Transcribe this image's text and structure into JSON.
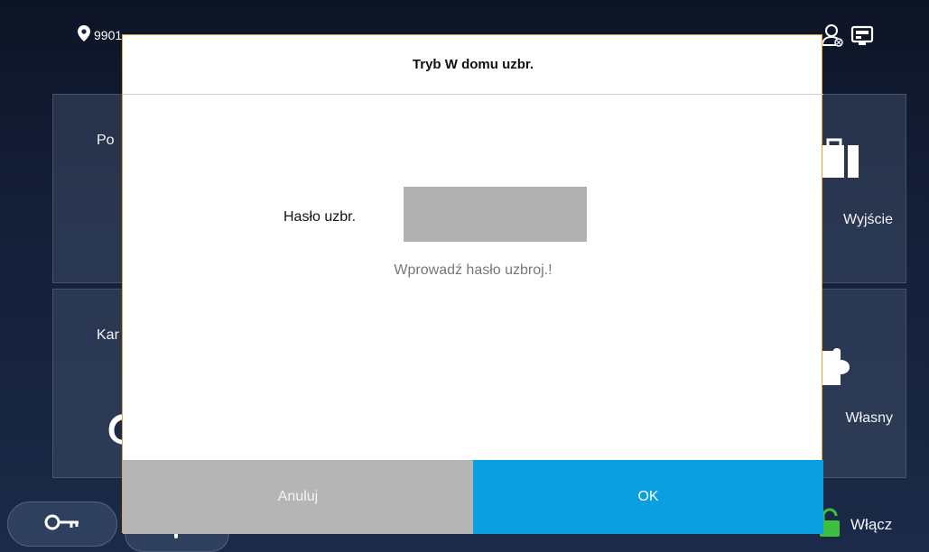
{
  "status_bar": {
    "location_text": "9901"
  },
  "tiles": {
    "left_top_label": "Po",
    "left_bottom_label": "Kar",
    "right_top_label": "Wyjście",
    "right_bottom_label": "Własny"
  },
  "bottom_bar": {
    "arm_label": "Włącz"
  },
  "dialog": {
    "title": "Tryb W domu uzbr.",
    "password_label": "Hasło uzbr.",
    "password_value": "",
    "hint": "Wprowadź hasło uzbroj.!",
    "cancel_label": "Anuluj",
    "ok_label": "OK"
  },
  "colors": {
    "ok_button": "#0a9fe0",
    "cancel_button": "#b5b5b5",
    "dialog_border": "#e8a23c",
    "arm_icon": "#3fbf3f"
  }
}
